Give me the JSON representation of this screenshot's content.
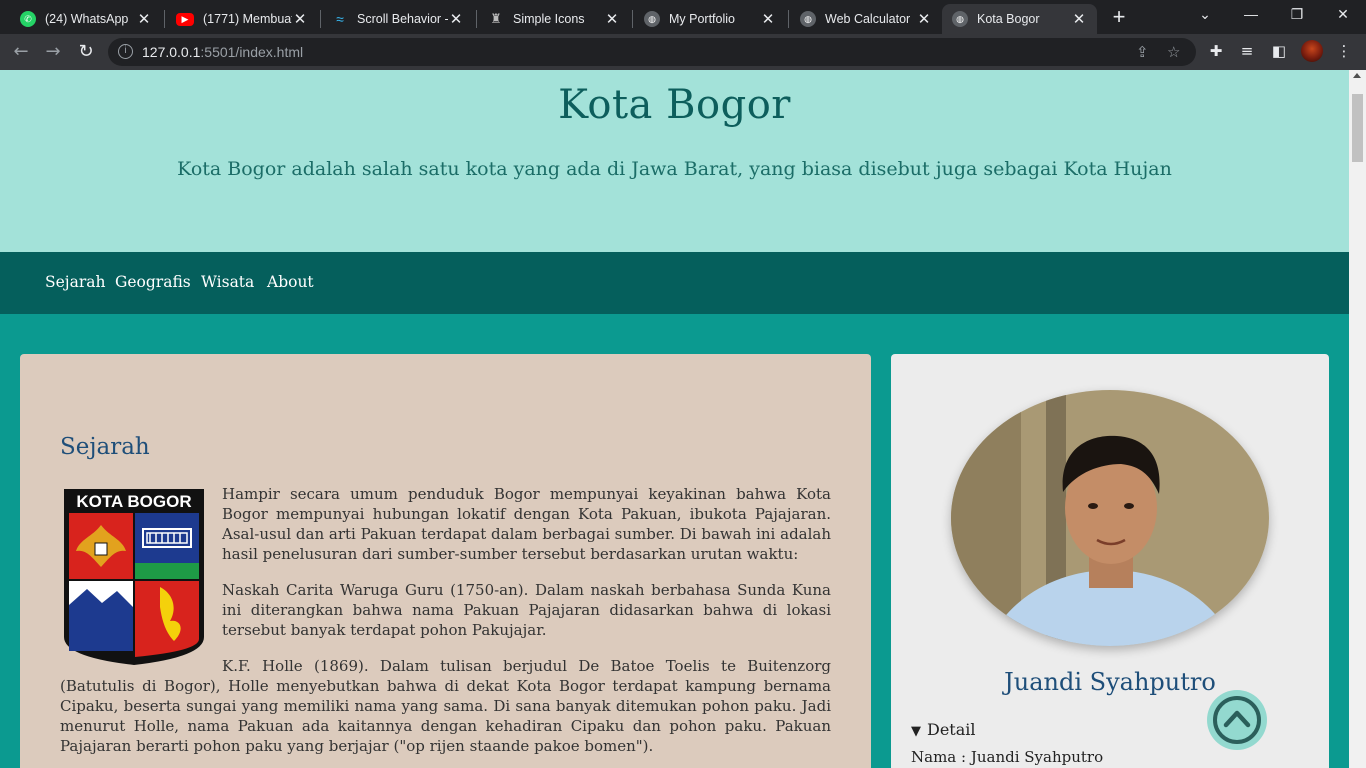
{
  "browser": {
    "tabs": [
      {
        "title": "(24) WhatsApp",
        "icon": "whatsapp-icon",
        "color": "#25d366"
      },
      {
        "title": "(1771) Membuat",
        "icon": "youtube-icon",
        "color": "#ff0000"
      },
      {
        "title": "Scroll Behavior -",
        "icon": "tailwind-icon",
        "color": "#38bdf8"
      },
      {
        "title": "Simple Icons",
        "icon": "simple-icons-icon",
        "color": "#bbbbbb"
      },
      {
        "title": "My Portfolio",
        "icon": "globe-icon",
        "color": "#9aa0a6"
      },
      {
        "title": "Web Calculator",
        "icon": "globe-icon",
        "color": "#9aa0a6"
      },
      {
        "title": "Kota Bogor",
        "icon": "globe-icon",
        "color": "#9aa0a6"
      }
    ],
    "active_tab": 6,
    "url_host": "127.0.0.1",
    "url_rest": ":5501/index.html",
    "tab_close_glyph": "✕",
    "new_tab_glyph": "+"
  },
  "hero": {
    "title": "Kota Bogor",
    "subtitle": "Kota Bogor adalah salah satu kota yang ada di Jawa Barat, yang biasa disebut juga sebagai Kota Hujan"
  },
  "nav": {
    "items": [
      "Sejarah",
      "Geografis",
      "Wisata",
      "About"
    ]
  },
  "article": {
    "heading": "Sejarah",
    "logo_text": "KOTA BOGOR",
    "paragraphs": [
      "Hampir secara umum penduduk Bogor mempunyai keyakinan bahwa Kota Bogor mempunyai hubungan lokatif dengan Kota Pakuan, ibukota Pajajaran. Asal-usul dan arti Pakuan terdapat dalam berbagai sumber. Di bawah ini adalah hasil penelusuran dari sumber-sumber tersebut berdasarkan urutan waktu:",
      "Naskah Carita Waruga Guru (1750-an). Dalam naskah berbahasa Sunda Kuna ini diterangkan bahwa nama Pakuan Pajajaran didasarkan bahwa di lokasi tersebut banyak terdapat pohon Pakujajar.",
      "K.F. Holle (1869). Dalam tulisan berjudul De Batoe Toelis te Buitenzorg (Batutulis di Bogor), Holle menyebutkan bahwa di dekat Kota Bogor terdapat kampung bernama Cipaku, beserta sungai yang memiliki nama yang sama. Di sana banyak ditemukan pohon paku. Jadi menurut Holle, nama Pakuan ada kaitannya dengan kehadiran Cipaku dan pohon paku. Pakuan Pajajaran berarti pohon paku yang berjajar (\"op rijen staande pakoe bomen\")."
    ]
  },
  "profile": {
    "name": "Juandi Syahputro",
    "detail_label": "Detail",
    "name_line": "Nama : Juandi Syahputro"
  },
  "colors": {
    "page_bg": "#0b9a90",
    "hero_bg": "#a3e2d9",
    "nav_bg": "#055f5c",
    "card_bg": "#dccbbd",
    "side_bg": "#ececec",
    "heading": "#1e4e79"
  }
}
